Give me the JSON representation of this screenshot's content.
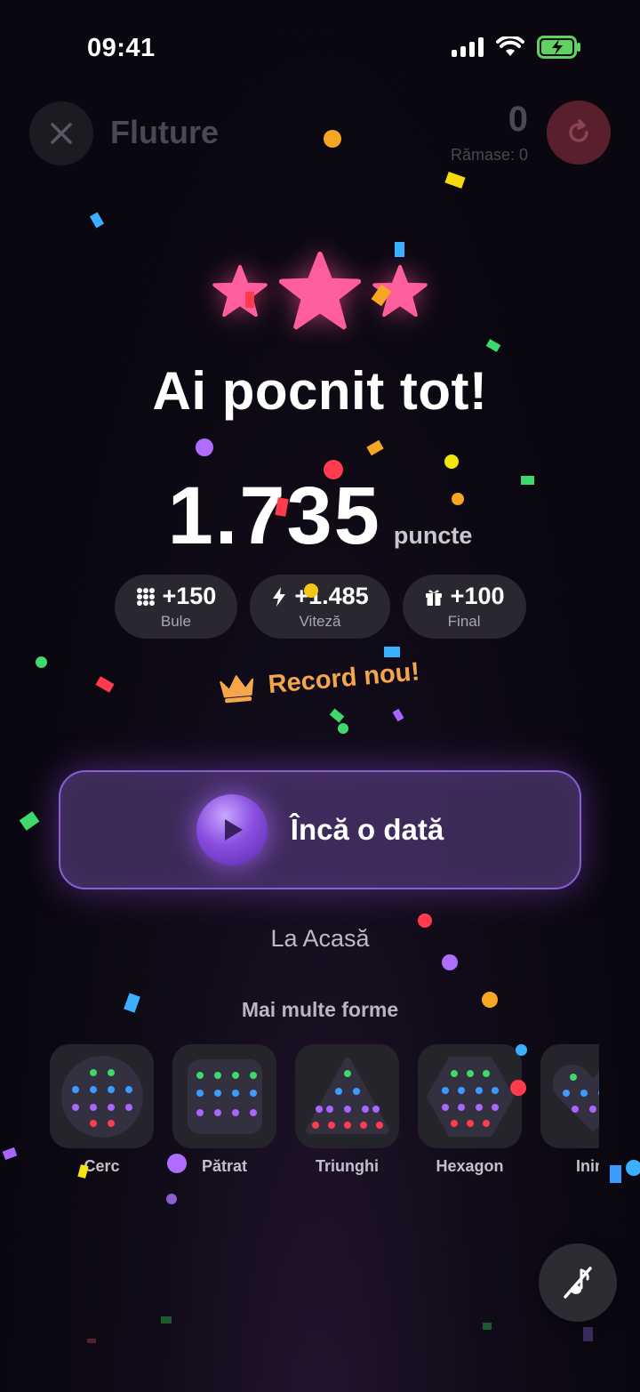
{
  "status": {
    "time": "09:41"
  },
  "topbar": {
    "title": "Fluture",
    "score": "0",
    "remaining": "Rămase: 0"
  },
  "result": {
    "headline": "Ai pocnit tot!",
    "score": "1.735",
    "score_unit": "puncte",
    "stars_earned": 3,
    "stars_total": 3
  },
  "bonuses": [
    {
      "value": "+150",
      "label": "Bule",
      "icon": "grid-icon"
    },
    {
      "value": "+1.485",
      "label": "Viteză",
      "icon": "lightning-icon"
    },
    {
      "value": "+100",
      "label": "Final",
      "icon": "gift-icon"
    }
  ],
  "record": {
    "label": "Record nou!",
    "icon": "crown-icon"
  },
  "actions": {
    "play_again": "Încă o dată",
    "home": "La Acasă"
  },
  "more_shapes": {
    "title": "Mai multe forme",
    "items": [
      {
        "label": "Cerc"
      },
      {
        "label": "Pătrat"
      },
      {
        "label": "Triunghi"
      },
      {
        "label": "Hexagon"
      },
      {
        "label": "Inim"
      }
    ]
  },
  "colors": {
    "star": "#ff5e9c",
    "accent_purple": "#8a5fd0",
    "record_orange": "#f5a64b",
    "background": "#0a0710"
  }
}
